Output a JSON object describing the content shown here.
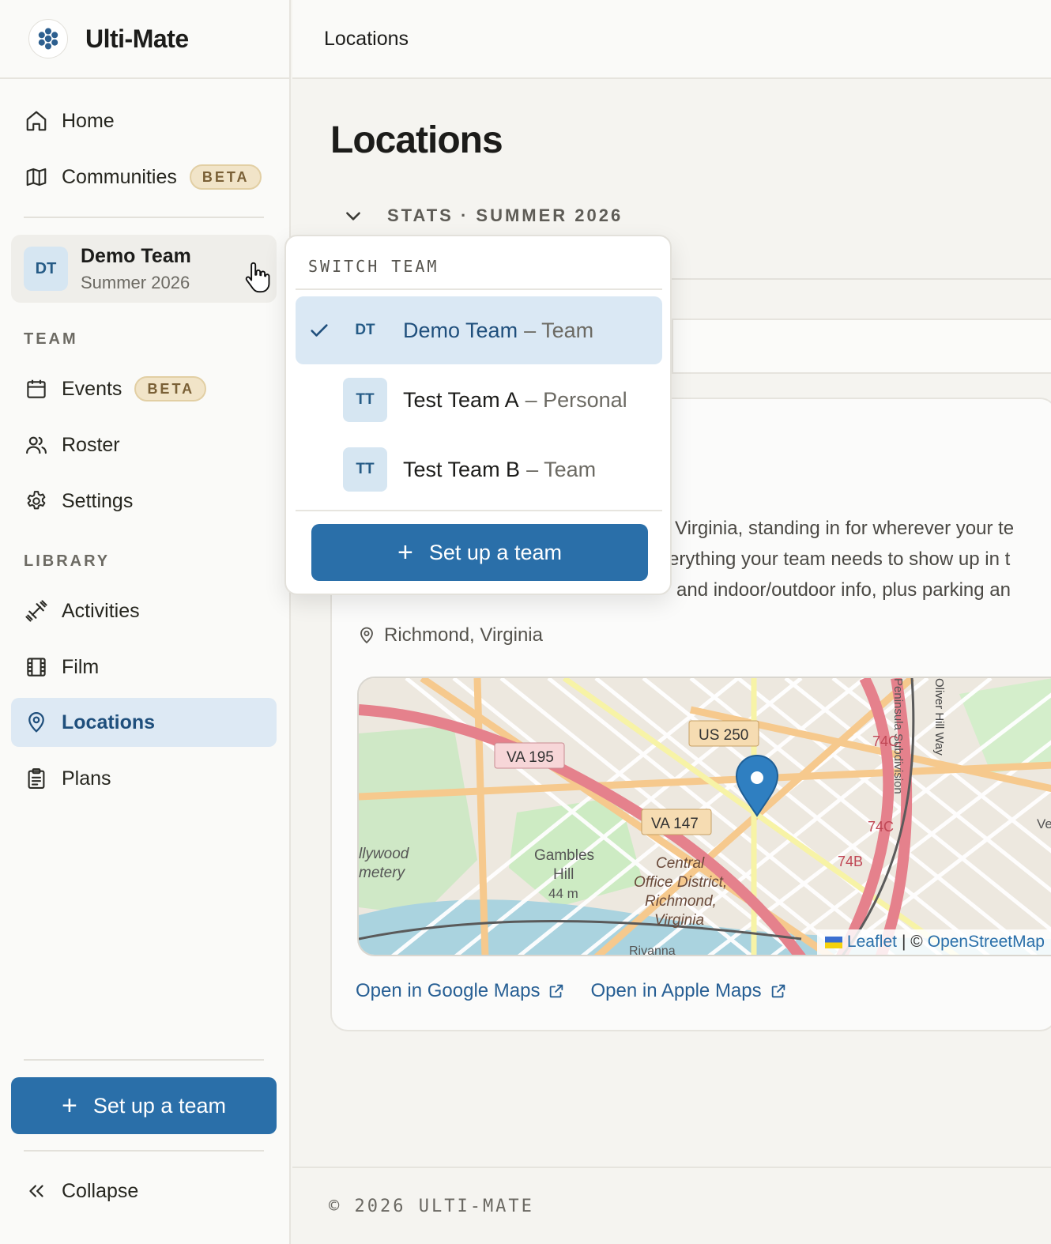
{
  "brand": {
    "name": "Ulti-Mate"
  },
  "sidebar": {
    "nav_top": [
      {
        "label": "Home",
        "icon": "home-icon"
      },
      {
        "label": "Communities",
        "icon": "map-icon",
        "badge": "BETA"
      }
    ],
    "team_switcher": {
      "initials": "DT",
      "name": "Demo Team",
      "season": "Summer 2026"
    },
    "team_section": {
      "label": "TEAM",
      "items": [
        {
          "label": "Events",
          "icon": "calendar-icon",
          "badge": "BETA"
        },
        {
          "label": "Roster",
          "icon": "users-icon"
        },
        {
          "label": "Settings",
          "icon": "gear-icon"
        }
      ]
    },
    "library_section": {
      "label": "LIBRARY",
      "items": [
        {
          "label": "Activities",
          "icon": "dumbbell-icon"
        },
        {
          "label": "Film",
          "icon": "film-icon"
        },
        {
          "label": "Locations",
          "icon": "map-pin-icon",
          "active": true
        },
        {
          "label": "Plans",
          "icon": "clipboard-icon"
        }
      ]
    },
    "setup_button": "Set up a team",
    "collapse_label": "Collapse"
  },
  "header": {
    "breadcrumb": "Locations"
  },
  "main": {
    "title": "Locations",
    "stats_label": "STATS · SUMMER 2026",
    "location_card": {
      "description_lines": [
        "Virginia, standing in for wherever your te",
        "erything your team needs to show up in t",
        "and indoor/outdoor info, plus parking an"
      ],
      "location": "Richmond, Virginia",
      "map": {
        "labels": [
          "VA 195",
          "US 250",
          "VA 147",
          "74C",
          "74C",
          "74B",
          "Gambles",
          "Hill",
          "44 m",
          "Central",
          "Office District,",
          "Richmond,",
          "Virginia",
          "llywood",
          "metery",
          "Oliver Hill Way",
          "Peninsula Subdivision",
          "Ve",
          "Rivanna"
        ],
        "attribution_leaflet": "Leaflet",
        "attribution_sep": "| ©",
        "attribution_osm": "OpenStreetMap"
      },
      "links": [
        "Open in Google Maps",
        "Open in Apple Maps"
      ]
    }
  },
  "dropdown": {
    "header": "SWITCH TEAM",
    "teams": [
      {
        "initials": "DT",
        "name": "Demo Team",
        "kind": "– Team",
        "selected": true
      },
      {
        "initials": "TT",
        "name": "Test Team A",
        "kind": "– Personal",
        "selected": false
      },
      {
        "initials": "TT",
        "name": "Test Team B",
        "kind": "– Team",
        "selected": false
      }
    ],
    "setup_button": "Set up a team"
  },
  "footer": {
    "copyright": "© 2026 ULTI-MATE"
  },
  "colors": {
    "accent": "#2a6fa9",
    "active_bg": "#dde9f4",
    "beta_bg": "#f1e4c8"
  }
}
